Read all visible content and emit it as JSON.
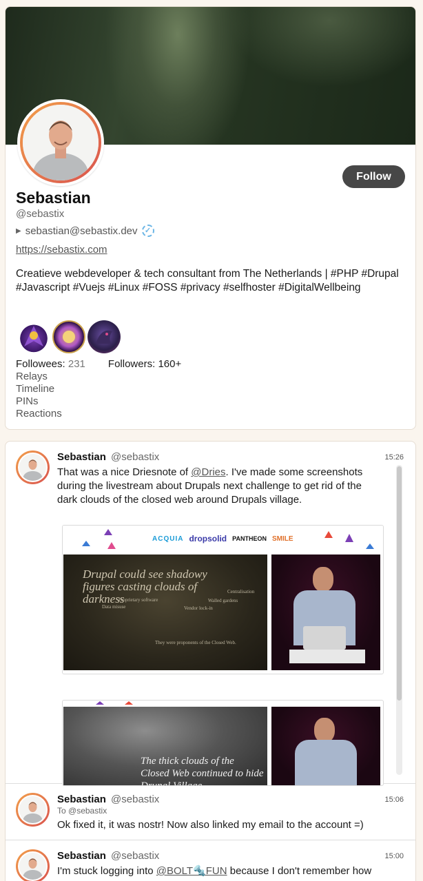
{
  "profile": {
    "display_name": "Sebastian",
    "handle": "@sebastix",
    "nip05": "sebastian@sebastix.dev",
    "website": "https://sebastix.com",
    "bio": "Creatieve webdeveloper & tech consultant from The Netherlands | #PHP #Drupal #Javascript #Vuejs #Linux #FOSS #privacy #selfhoster #DigitalWellbeing",
    "follow_label": "Follow",
    "followees_label": "Followees:",
    "followees_count": "231",
    "followers_label": "Followers:",
    "followers_count": "160+",
    "nav": [
      "Relays",
      "Timeline",
      "PINs",
      "Reactions"
    ]
  },
  "notes": [
    {
      "name": "Sebastian",
      "handle": "@sebastix",
      "time": "15:26",
      "text_before": "That was a nice Driesnote of ",
      "mention": "@Dries",
      "text_after": ". I've made some screenshots during the livestream about Drupals next challenge to get rid of the dark clouds of the closed web around Drupals village."
    },
    {
      "name": "Sebastian",
      "handle": "@sebastix",
      "time": "15:06",
      "reply_to": "To @sebastix",
      "text": "Ok fixed it, it was nostr! Now also linked my email to the account =)"
    },
    {
      "name": "Sebastian",
      "handle": "@sebastix",
      "time": "15:00",
      "text_before": "I'm stuck logging into ",
      "mention": "@BOLT🔩FUN",
      "text_after": " because I don't remember how I"
    }
  ],
  "slides": {
    "sponsors": [
      "ACQUIA",
      "dropsolid",
      "PANTHEON",
      "SMILE"
    ],
    "slide1_title": "Drupal could see shadowy figures casting clouds of darkness",
    "slide1_terms": [
      "Centralisation",
      "Proprietary software",
      "Walled gardens",
      "Data misuse",
      "Vendor lock-in"
    ],
    "slide1_footer": "They were proponents of the Closed Web.",
    "slide2_title": "The thick clouds of the Closed Web continued to hide Drupal Village"
  },
  "colors": {
    "follow_bg": "#474747",
    "avatar_ring_start": "#f2a04a",
    "avatar_ring_end": "#d9534f",
    "page_bg": "#faf5ee",
    "verified": "#6cb6e6"
  }
}
